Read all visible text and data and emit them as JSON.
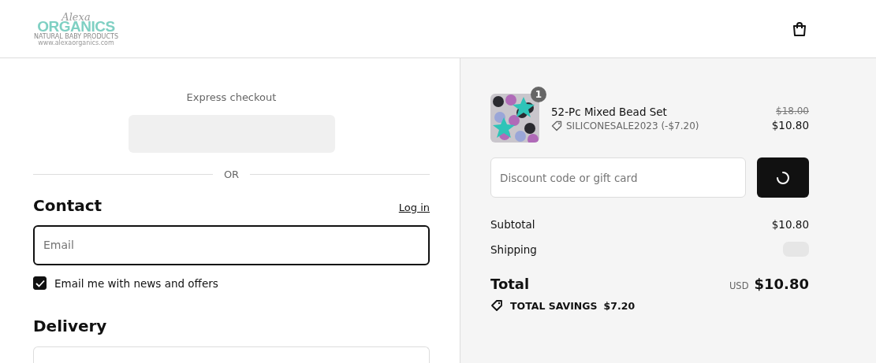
{
  "header": {
    "logo": {
      "script": "Alexa",
      "name": "ORGANICS",
      "tagline": "NATURAL BABY PRODUCTS",
      "url": "www.alexaorganics.com"
    }
  },
  "checkout": {
    "express_label": "Express checkout",
    "divider": "OR",
    "contact": {
      "heading": "Contact",
      "login_link": "Log in",
      "email": {
        "placeholder": "Email"
      },
      "newsletter": {
        "label": "Email me with news and offers",
        "checked": true
      }
    },
    "delivery": {
      "heading": "Delivery"
    }
  },
  "summary": {
    "items": [
      {
        "kind": "picture",
        "quantity": "1",
        "name": "52-Pc Mixed Bead Set",
        "discount": "SILICONESALE2023 (-$7.20)",
        "original_price": "$18.00",
        "price": "$10.80"
      }
    ],
    "discount_field": {
      "placeholder": "Discount code or gift card"
    },
    "subtotal": {
      "label": "Subtotal",
      "value": "$10.80"
    },
    "shipping": {
      "label": "Shipping"
    },
    "total": {
      "label": "Total",
      "currency": "USD",
      "value": "$10.80"
    },
    "savings": {
      "label": "TOTAL SAVINGS",
      "value": "$7.20"
    }
  }
}
